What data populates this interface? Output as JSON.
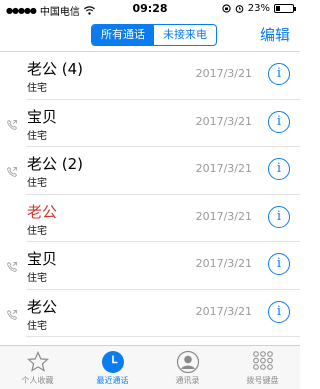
{
  "status_bar": {
    "carrier": "中国电信",
    "signal_icon": "cellular-signal",
    "wifi_icon": "wifi",
    "time": "09:28",
    "lock_icon": "orientation-lock",
    "alarm_icon": "alarm",
    "battery_percent": "23%",
    "battery_level": 0.23
  },
  "nav": {
    "segments": [
      {
        "label": "所有通话",
        "active": true
      },
      {
        "label": "未接来电",
        "active": false
      }
    ],
    "edit_label": "编辑"
  },
  "calls": [
    {
      "name": "老公 (4)",
      "type": "住宅",
      "date": "2017/3/21",
      "missed": false,
      "outgoing": false
    },
    {
      "name": "宝贝",
      "type": "住宅",
      "date": "2017/3/21",
      "missed": false,
      "outgoing": true
    },
    {
      "name": "老公 (2)",
      "type": "住宅",
      "date": "2017/3/21",
      "missed": false,
      "outgoing": true
    },
    {
      "name": "老公",
      "type": "住宅",
      "date": "2017/3/21",
      "missed": true,
      "outgoing": false
    },
    {
      "name": "宝贝",
      "type": "住宅",
      "date": "2017/3/21",
      "missed": false,
      "outgoing": true
    },
    {
      "name": "老公",
      "type": "住宅",
      "date": "2017/3/21",
      "missed": false,
      "outgoing": true
    }
  ],
  "info_glyph": "i",
  "tabs": [
    {
      "label": "个人收藏",
      "icon": "star-icon",
      "active": false
    },
    {
      "label": "最近通话",
      "icon": "clock-icon",
      "active": true
    },
    {
      "label": "通讯录",
      "icon": "contacts-icon",
      "active": false
    },
    {
      "label": "拨号键盘",
      "icon": "keypad-icon",
      "active": false
    }
  ],
  "colors": {
    "accent": "#0a7cf0",
    "missed": "#d0382f",
    "secondary_text": "#9a9a9a"
  }
}
